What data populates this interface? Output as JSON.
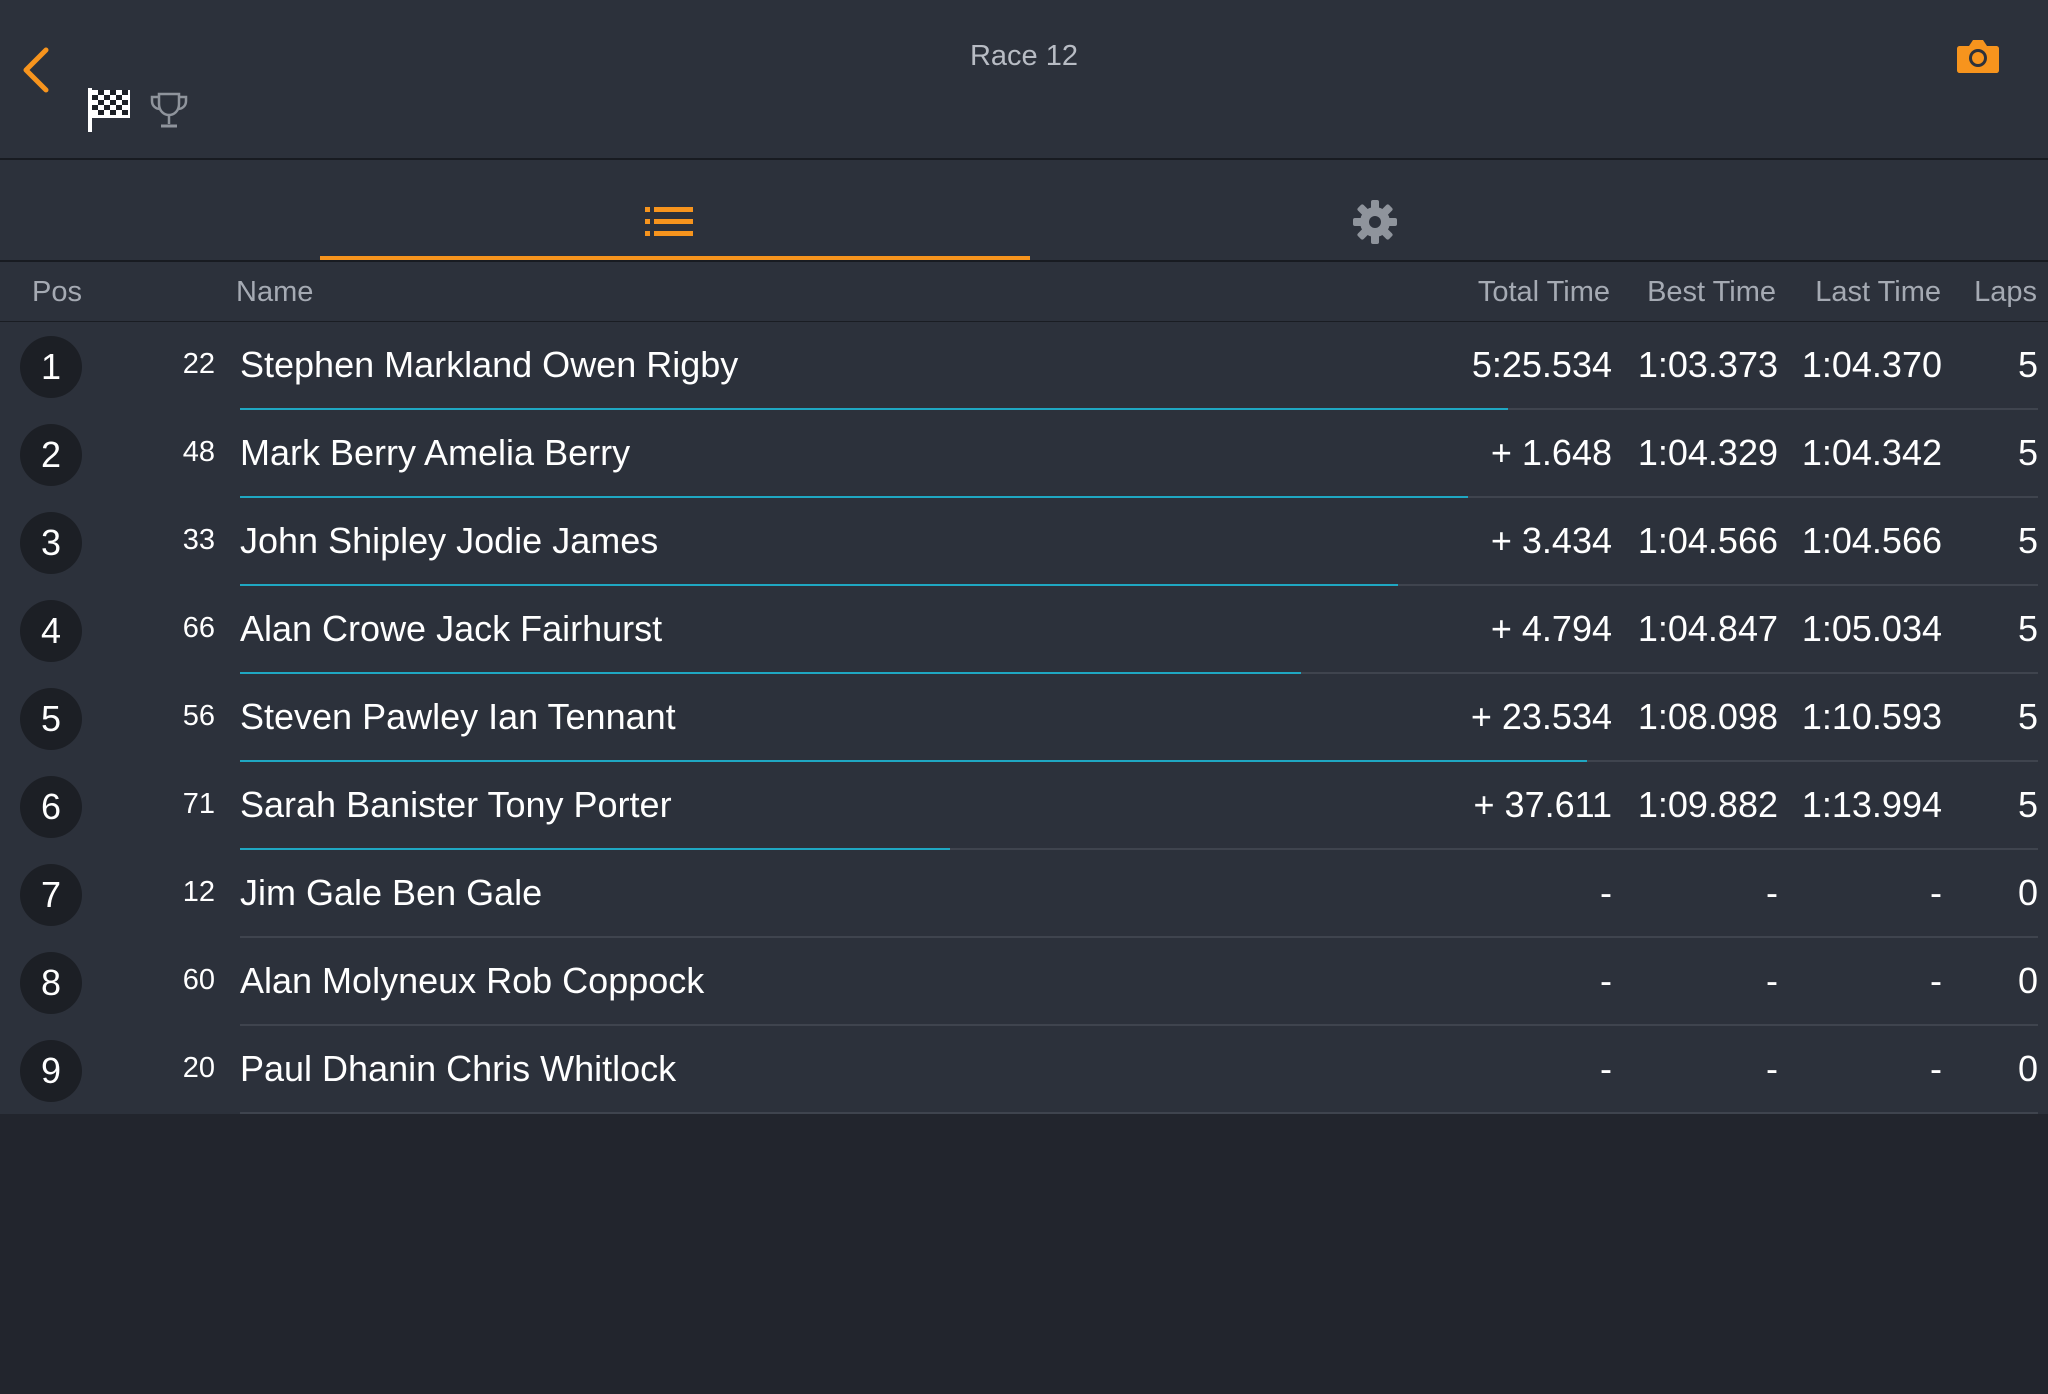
{
  "header": {
    "title": "Race 12",
    "back_icon": "chevron-left-icon",
    "flag_icon": "checkered-flag-icon",
    "trophy_icon": "trophy-icon",
    "camera_icon": "camera-icon"
  },
  "tabs": [
    {
      "icon": "list-icon",
      "active": true
    },
    {
      "icon": "gear-icon",
      "active": false
    }
  ],
  "colors": {
    "accent": "#f7941d",
    "progress": "#1fa7c2",
    "background": "#2c313b"
  },
  "columns": {
    "pos": "Pos",
    "name": "Name",
    "total": "Total Time",
    "best": "Best Time",
    "last": "Last Time",
    "laps": "Laps"
  },
  "rows": [
    {
      "pos": "1",
      "number": "22",
      "name": "Stephen Markland Owen Rigby",
      "total": "5:25.534",
      "best": "1:03.373",
      "last": "1:04.370",
      "laps": "5",
      "progress": 0.705
    },
    {
      "pos": "2",
      "number": "48",
      "name": "Mark Berry Amelia Berry",
      "total": "+ 1.648",
      "best": "1:04.329",
      "last": "1:04.342",
      "laps": "5",
      "progress": 0.683
    },
    {
      "pos": "3",
      "number": "33",
      "name": "John Shipley Jodie James",
      "total": "+ 3.434",
      "best": "1:04.566",
      "last": "1:04.566",
      "laps": "5",
      "progress": 0.644
    },
    {
      "pos": "4",
      "number": "66",
      "name": "Alan Crowe Jack Fairhurst",
      "total": "+ 4.794",
      "best": "1:04.847",
      "last": "1:05.034",
      "laps": "5",
      "progress": 0.59
    },
    {
      "pos": "5",
      "number": "56",
      "name": "Steven Pawley Ian Tennant",
      "total": "+ 23.534",
      "best": "1:08.098",
      "last": "1:10.593",
      "laps": "5",
      "progress": 0.749
    },
    {
      "pos": "6",
      "number": "71",
      "name": "Sarah Banister Tony Porter",
      "total": "+ 37.611",
      "best": "1:09.882",
      "last": "1:13.994",
      "laps": "5",
      "progress": 0.395
    },
    {
      "pos": "7",
      "number": "12",
      "name": "Jim Gale Ben Gale",
      "total": "-",
      "best": "-",
      "last": "-",
      "laps": "0",
      "progress": 0
    },
    {
      "pos": "8",
      "number": "60",
      "name": "Alan Molyneux Rob Coppock",
      "total": "-",
      "best": "-",
      "last": "-",
      "laps": "0",
      "progress": 0
    },
    {
      "pos": "9",
      "number": "20",
      "name": "Paul Dhanin Chris Whitlock",
      "total": "-",
      "best": "-",
      "last": "-",
      "laps": "0",
      "progress": 0
    }
  ]
}
